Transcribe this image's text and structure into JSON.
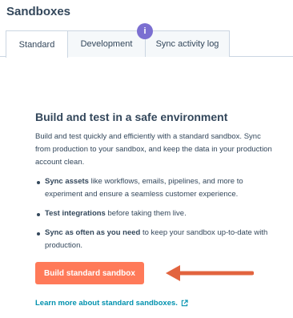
{
  "page": {
    "title": "Sandboxes"
  },
  "tabs": [
    {
      "label": "Standard",
      "active": true
    },
    {
      "label": "Development",
      "active": false
    },
    {
      "label": "Sync activity log",
      "active": false
    }
  ],
  "info_badge": {
    "text": "i"
  },
  "main": {
    "heading": "Build and test in a safe environment",
    "intro": "Build and test quickly and efficiently with a standard sandbox. Sync from production to your sandbox, and keep the data in your production account clean.",
    "bullets": [
      {
        "bold": "Sync assets",
        "rest": " like workflows, emails, pipelines, and more to experiment and ensure a seamless customer experience."
      },
      {
        "bold": "Test integrations",
        "rest": " before taking them live."
      },
      {
        "bold": "Sync as often as you need",
        "rest": " to keep your sandbox up-to-date with production."
      }
    ],
    "build_button_label": "Build standard sandbox",
    "learn_more_label": "Learn more about standard sandboxes."
  },
  "colors": {
    "accent_button": "#ff7a59",
    "link": "#0091ae",
    "arrow": "#e2643f",
    "badge": "#7b6fd1"
  },
  "icons": {
    "arrow": "left-arrow-icon",
    "external_link": "external-link-icon",
    "info": "info-icon"
  }
}
